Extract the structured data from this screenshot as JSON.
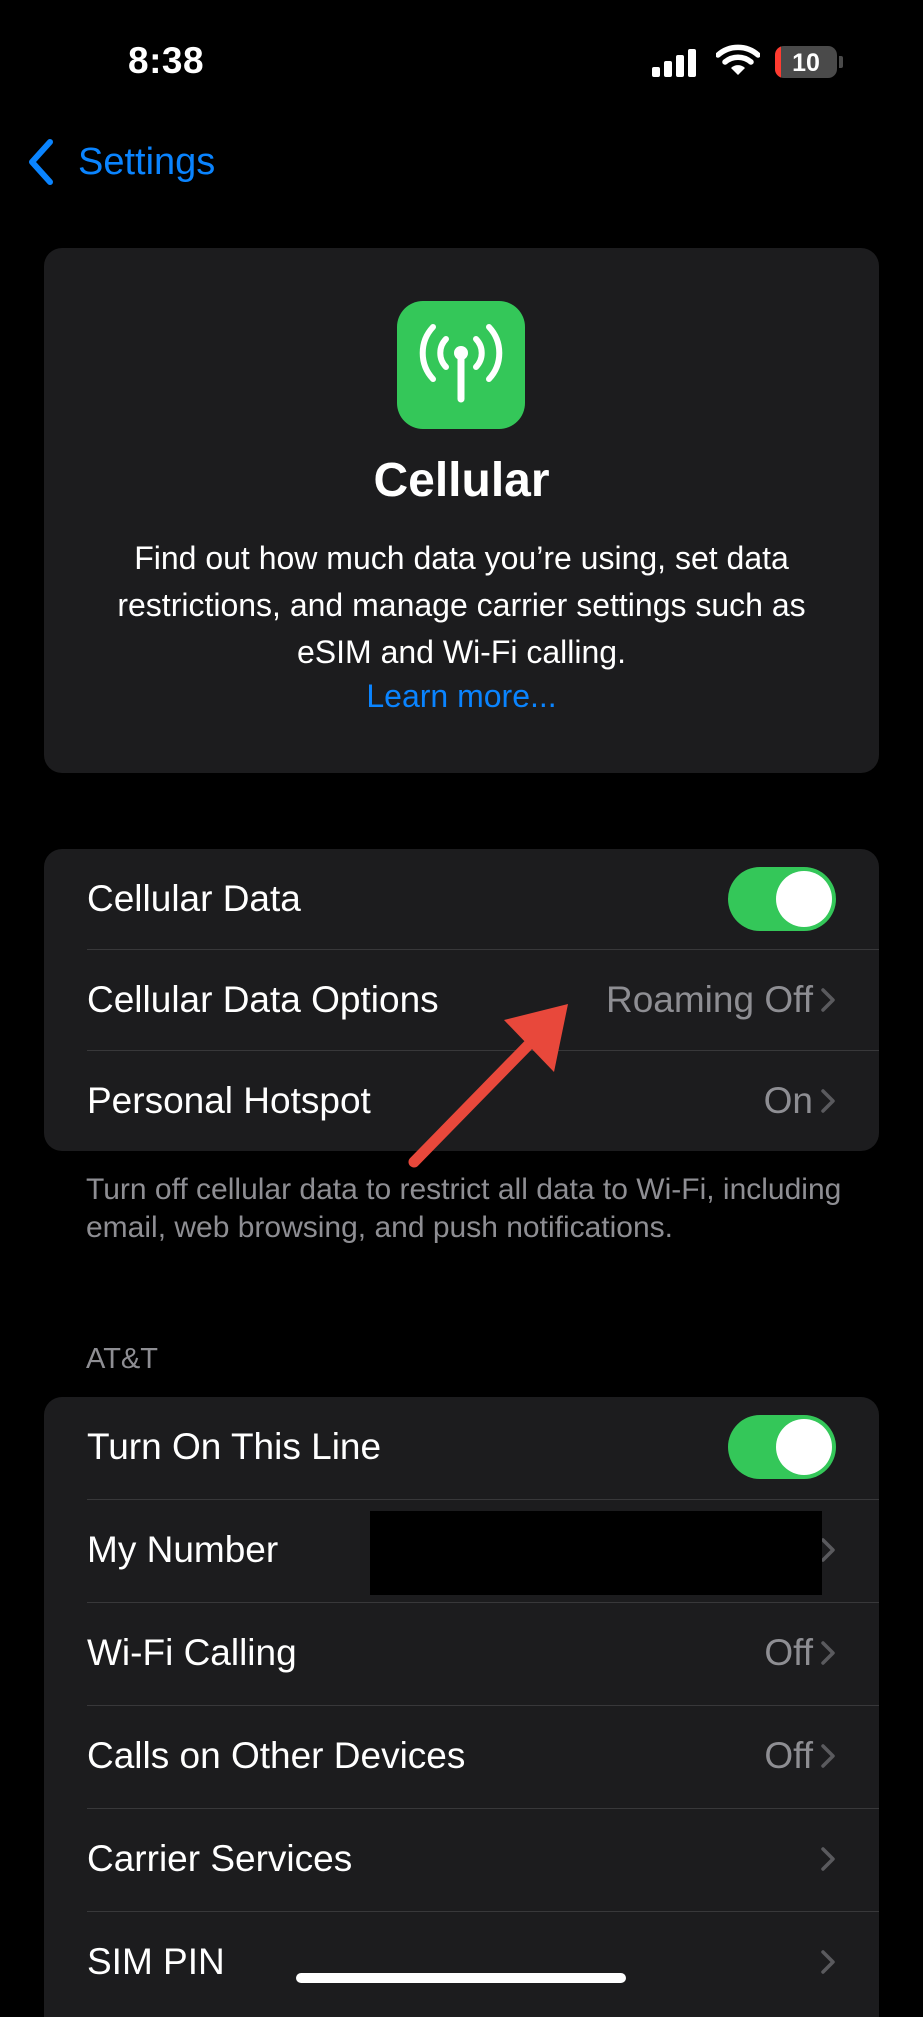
{
  "status_bar": {
    "time": "8:38",
    "battery_level": "10",
    "battery_fraction": 0.1,
    "icons": [
      "signal-icon",
      "wifi-icon",
      "battery-icon"
    ]
  },
  "nav": {
    "back_label": "Settings"
  },
  "hero": {
    "icon": "antenna-icon",
    "title": "Cellular",
    "description": "Find out how much data you’re using, set data restrictions, and manage carrier settings such as eSIM and Wi-Fi calling.",
    "link": "Learn more..."
  },
  "group1": {
    "rows": [
      {
        "label": "Cellular Data",
        "toggle": true
      },
      {
        "label": "Cellular Data Options",
        "value": "Roaming Off"
      },
      {
        "label": "Personal Hotspot",
        "value": "On"
      }
    ],
    "footer": "Turn off cellular data to restrict all data to Wi-Fi, including email, web browsing, and push notifications."
  },
  "carrier_section": {
    "header": "AT&T",
    "rows": [
      {
        "label": "Turn On This Line",
        "toggle": true
      },
      {
        "label": "My Number",
        "value": ""
      },
      {
        "label": "Wi-Fi Calling",
        "value": "Off"
      },
      {
        "label": "Calls on Other Devices",
        "value": "Off"
      },
      {
        "label": "Carrier Services",
        "value": ""
      },
      {
        "label": "SIM PIN",
        "value": ""
      }
    ]
  },
  "colors": {
    "accent": "#0a84ff",
    "toggle_on": "#34c759",
    "battery_low": "#ff3b30",
    "annotation_arrow": "#e8483b"
  }
}
